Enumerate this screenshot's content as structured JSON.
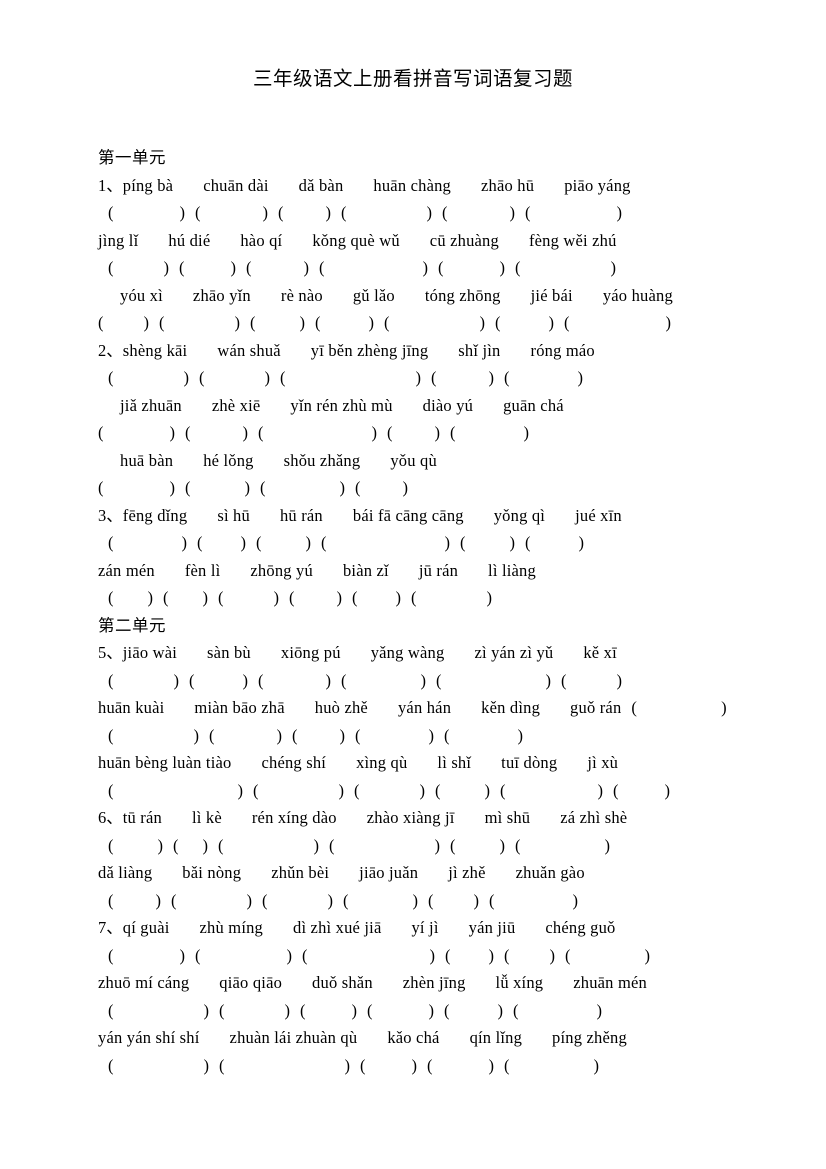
{
  "document": {
    "title": "三年级语文上册看拼音写词语复习题"
  },
  "units": [
    {
      "heading": "第一单元",
      "exercises": [
        {
          "number": "1、",
          "lines": [
            {
              "type": "pinyin",
              "indent": 0,
              "number": "1、",
              "words": [
                "píng bà",
                "chuān dài",
                "dǎ bàn",
                "huān chàng",
                "zhāo hū",
                "piāo yáng"
              ]
            },
            {
              "type": "brackets",
              "indent": 1,
              "widths": [
                66,
                62,
                42,
                80,
                62,
                86
              ]
            },
            {
              "type": "pinyin",
              "indent": 0,
              "number": "",
              "words": [
                "jìng lǐ",
                "hú dié",
                "hào qí",
                "kǒng què wǔ",
                "cū zhuàng",
                "fèng wěi zhú"
              ]
            },
            {
              "type": "brackets",
              "indent": 1,
              "widths": [
                50,
                46,
                52,
                98,
                56,
                90
              ]
            },
            {
              "type": "pinyin",
              "indent": 2,
              "number": "",
              "words": [
                "yóu xì",
                "zhāo yǐn",
                "rè nào",
                "gǔ lǎo",
                "tóng zhōng",
                "jié bái",
                "yáo huàng"
              ]
            },
            {
              "type": "brackets",
              "indent": 0,
              "widths": [
                40,
                70,
                44,
                48,
                90,
                48,
                96
              ]
            }
          ]
        },
        {
          "number": "2、",
          "lines": [
            {
              "type": "pinyin",
              "indent": 0,
              "number": "2、",
              "words": [
                "shèng kāi",
                "wán shuǎ",
                "yī běn zhèng jīng",
                "shǐ jìn",
                "róng máo"
              ]
            },
            {
              "type": "brackets",
              "indent": 1,
              "widths": [
                70,
                60,
                130,
                52,
                68
              ]
            },
            {
              "type": "pinyin",
              "indent": 2,
              "number": "",
              "words": [
                "jiǎ zhuān",
                "zhè xiē",
                "yǐn rén zhù mù",
                "diào yú",
                "guān chá"
              ]
            },
            {
              "type": "brackets",
              "indent": 0,
              "widths": [
                66,
                52,
                108,
                42,
                68
              ]
            },
            {
              "type": "pinyin",
              "indent": 2,
              "number": "",
              "words": [
                "huā bàn",
                "hé lǒng",
                "shǒu zhǎng",
                "yǒu qù"
              ]
            },
            {
              "type": "brackets",
              "indent": 0,
              "widths": [
                66,
                54,
                74,
                42
              ]
            }
          ]
        },
        {
          "number": "3、",
          "lines": [
            {
              "type": "pinyin",
              "indent": 0,
              "number": "3、",
              "words": [
                "fēng dǐng",
                "sì hū",
                "hū rán",
                "bái fā cāng cāng",
                "yǒng qì",
                "jué xīn"
              ]
            },
            {
              "type": "brackets",
              "indent": 1,
              "widths": [
                68,
                38,
                44,
                118,
                44,
                48
              ]
            },
            {
              "type": "pinyin",
              "indent": 0,
              "number": "",
              "words": [
                "zán mén",
                "fèn lì",
                "zhōng yú",
                "biàn zǐ",
                "jū rán",
                "lì liàng"
              ]
            },
            {
              "type": "brackets",
              "indent": 1,
              "widths": [
                34,
                34,
                50,
                42,
                38,
                70
              ]
            }
          ]
        }
      ]
    },
    {
      "heading": "第二单元",
      "exercises": [
        {
          "number": "5、",
          "lines": [
            {
              "type": "pinyin",
              "indent": 0,
              "number": "5、",
              "words": [
                "jiāo wài",
                "sàn bù",
                "xiōng pú",
                "yǎng wàng",
                "zì yán zì yǔ",
                "kě xī"
              ]
            },
            {
              "type": "brackets",
              "indent": 1,
              "widths": [
                60,
                48,
                62,
                74,
                104,
                50
              ]
            },
            {
              "type": "pinyin_trail",
              "indent": 0,
              "number": "",
              "words": [
                "huān kuài",
                "miàn bāo zhā",
                "huò zhě",
                "yán hán",
                "kěn dìng",
                "guǒ rán"
              ],
              "trailing_bracket_width": 84
            },
            {
              "type": "brackets",
              "indent": 1,
              "widths": [
                80,
                62,
                42,
                68,
                68
              ]
            },
            {
              "type": "pinyin",
              "indent": 0,
              "number": "",
              "words": [
                "huān bèng luàn tiào",
                "chéng shí",
                "xìng qù",
                "lì shǐ",
                "tuī dòng",
                "jì xù"
              ]
            },
            {
              "type": "brackets",
              "indent": 1,
              "widths": [
                124,
                80,
                60,
                44,
                92,
                46
              ]
            }
          ]
        },
        {
          "number": "6、",
          "lines": [
            {
              "type": "pinyin",
              "indent": 0,
              "number": "6、",
              "words": [
                "tū rán",
                "lì kè",
                "rén xíng dào",
                "zhào xiàng jī",
                "mì shū",
                "zá zhì shè"
              ]
            },
            {
              "type": "brackets",
              "indent": 1,
              "widths": [
                44,
                24,
                90,
                100,
                44,
                84
              ]
            },
            {
              "type": "pinyin",
              "indent": 0,
              "number": "",
              "words": [
                "dǎ liàng",
                "bǎi nòng",
                "zhǔn bèi",
                "jiāo juǎn",
                "jì zhě",
                "zhuǎn gào"
              ]
            },
            {
              "type": "brackets",
              "indent": 1,
              "widths": [
                42,
                70,
                60,
                64,
                40,
                78
              ]
            }
          ]
        },
        {
          "number": "7、",
          "lines": [
            {
              "type": "pinyin",
              "indent": 0,
              "number": "7、",
              "words": [
                "qí guài",
                "zhù míng",
                "dì zhì xué jiā",
                "yí jì",
                "yán jiū",
                "chéng guǒ"
              ]
            },
            {
              "type": "brackets",
              "indent": 1,
              "widths": [
                66,
                86,
                122,
                38,
                40,
                74
              ]
            },
            {
              "type": "pinyin",
              "indent": 0,
              "number": "",
              "words": [
                "zhuō mí cáng",
                "qiāo qiāo",
                "duǒ shǎn",
                "zhèn jīng",
                "lǚ xíng",
                "zhuān mén"
              ]
            },
            {
              "type": "brackets",
              "indent": 1,
              "widths": [
                90,
                60,
                46,
                56,
                48,
                78
              ]
            },
            {
              "type": "pinyin",
              "indent": 0,
              "number": "",
              "words": [
                "yán yán shí shí",
                "zhuàn lái zhuàn qù",
                "kǎo chá",
                "qín lǐng",
                "píng zhěng"
              ]
            },
            {
              "type": "brackets",
              "indent": 1,
              "widths": [
                90,
                120,
                46,
                56,
                84
              ]
            }
          ]
        }
      ]
    }
  ],
  "glyphs": {
    "open_paren": "（",
    "close_paren": "）",
    "open_paren_half": "(",
    "close_paren_half": ")"
  },
  "colors": {
    "text": "#000000",
    "page_background": "#ffffff"
  }
}
